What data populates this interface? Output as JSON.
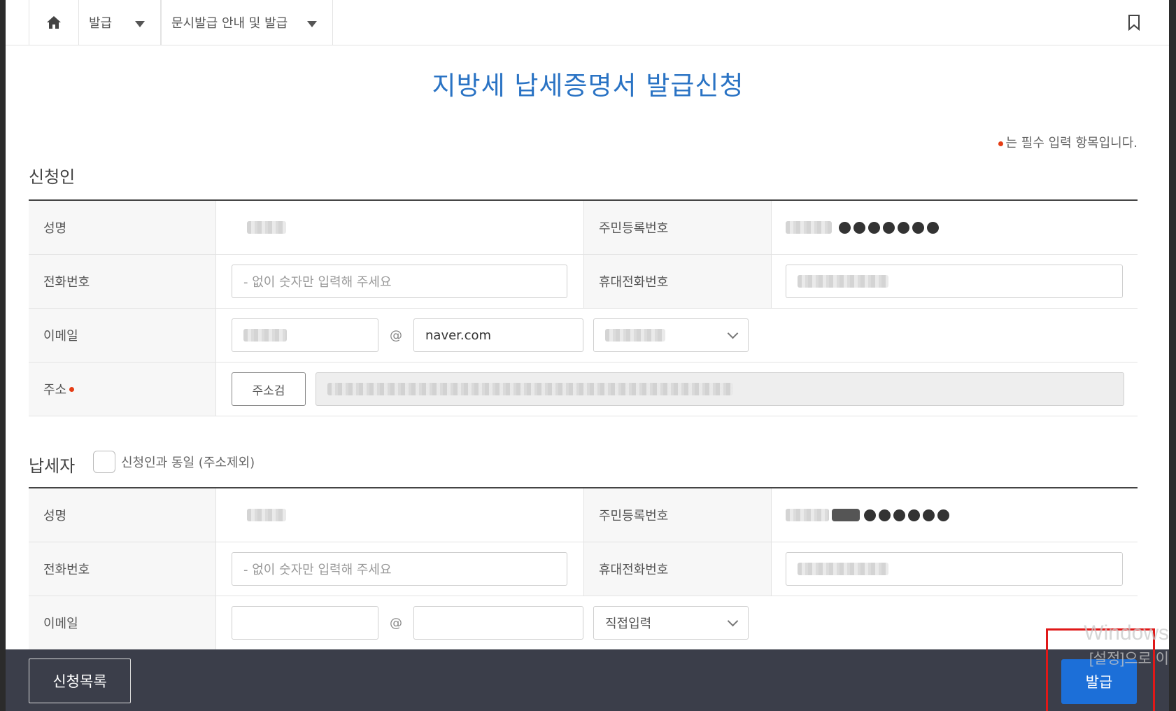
{
  "nav": {
    "home_icon": "home-icon",
    "dropdown1": "발급",
    "dropdown2": "문시발급 안내 및 발급",
    "bookmark_icon": "bookmark-icon"
  },
  "page": {
    "title": "지방세 납세증명서 발급신청",
    "required_note": "는 필수 입력 항목입니다."
  },
  "applicant": {
    "section_title": "신청인",
    "name_label": "성명",
    "rrn_label": "주민등록번호",
    "phone_label": "전화번호",
    "phone_placeholder": "- 없이 숫자만 입력해 주세요",
    "mobile_label": "휴대전화번호",
    "email_label": "이메일",
    "email_at": "@",
    "email_domain": "naver.com",
    "address_label": "주소",
    "address_search": "주소검"
  },
  "taxpayer": {
    "section_title": "납세자",
    "same_as_applicant": "신청인과 동일 (주소제외)",
    "name_label": "성명",
    "rrn_label": "주민등록번호",
    "phone_label": "전화번호",
    "phone_placeholder": "- 없이 숫자만 입력해 주세요",
    "mobile_label": "휴대전화번호",
    "email_label": "이메일",
    "email_at": "@",
    "email_select": "직접입력"
  },
  "footer": {
    "list_button": "신청목록",
    "issue_button": "발급"
  },
  "watermark": {
    "line1": "Windows",
    "line2": "[설정]으로 이"
  },
  "colors": {
    "title_blue": "#2a73c4",
    "primary_button": "#1c6fd8",
    "bottom_bar": "#3b3e4a",
    "required_dot": "#e53d15",
    "highlight_box": "#e01818"
  }
}
